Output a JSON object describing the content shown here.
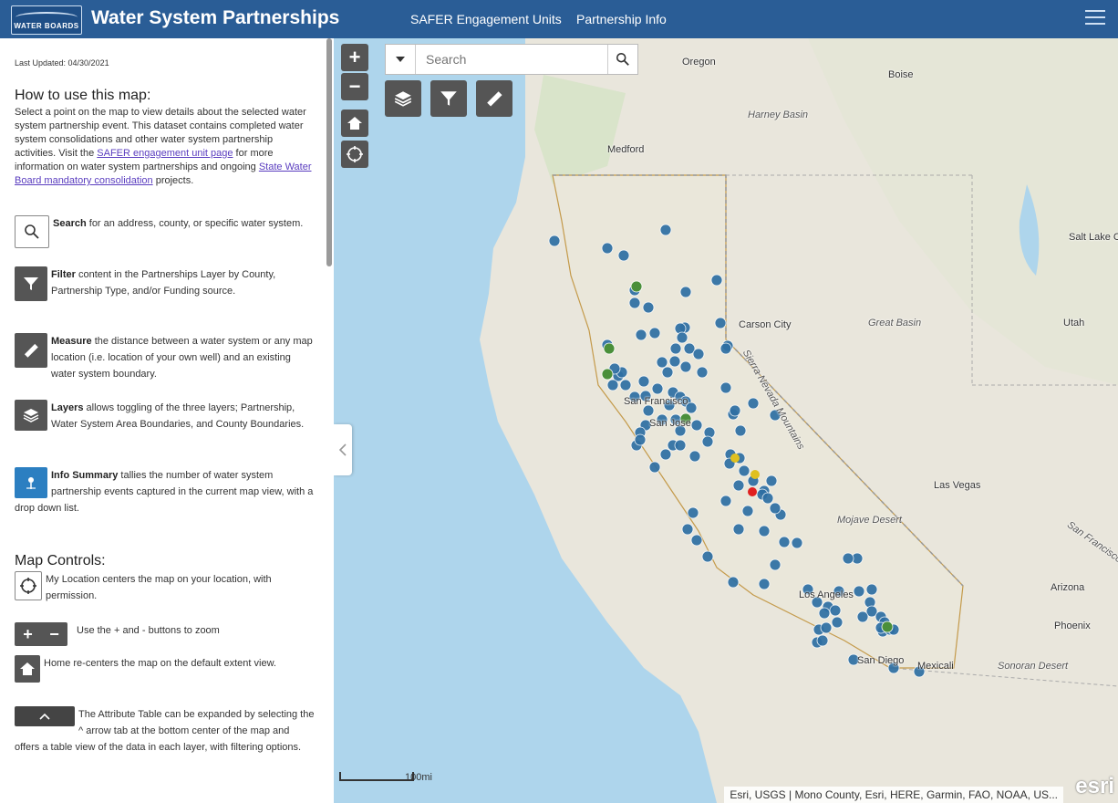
{
  "header": {
    "logo_text": "WATER BOARDS",
    "title": "Water System Partnerships",
    "nav": [
      "SAFER Engagement Units",
      "Partnership Info"
    ]
  },
  "sidebar": {
    "last_updated": "Last Updated: 04/30/2021",
    "how_to_heading": "How to use this map:",
    "intro_1": "Select a point on the map to view details about the selected water system partnership event. This dataset contains completed water system consolidations and other water system partnership activities. Visit the ",
    "intro_link_1": "SAFER engagement unit page",
    "intro_2": " for more information on water system partnerships and ongoing ",
    "intro_link_2": "State Water Board mandatory consolidation",
    "intro_3": " projects.",
    "search_bold": "Search",
    "search_text": " for an address, county, or specific water system.",
    "filter_bold": "Filter",
    "filter_text": " content in the Partnerships Layer by County, Partnership Type, and/or Funding source.",
    "measure_bold": "Measure",
    "measure_text": " the distance between a water system or any map location (i.e. location of your own well) and an existing water system boundary.",
    "layers_bold": "Layers",
    "layers_text": " allows toggling of the three layers; Partnership, Water System Area Boundaries, and County Boundaries.",
    "info_bold": "Info Summary",
    "info_text": " tallies the number of water system partnership events captured in the current map view, with a drop down list.",
    "controls_heading": "Map Controls:",
    "location_text": "My Location centers the map on your location, with permission.",
    "zoom_text": "Use the + and - buttons to zoom",
    "home_text": "Home re-centers the map on the default extent view.",
    "table_text": "The Attribute Table can be expanded by selecting the ^ arrow tab at the bottom center of the map and offers a table view of the data in each layer, with filtering options."
  },
  "map": {
    "search_placeholder": "Search",
    "zoom_in": "+",
    "zoom_out": "−",
    "scale_label": "100mi",
    "attribution": "Esri, USGS | Mono County, Esri, HERE, Garmin, FAO, NOAA, US...",
    "esri": "esri",
    "places": [
      "Oregon",
      "Boise",
      "Harney Basin",
      "Medford",
      "Carson City",
      "Great Basin",
      "Utah",
      "Salt Lake C",
      "San Francisco",
      "San Jose",
      "Las Vegas",
      "Mojave Desert",
      "Los Angeles",
      "San Diego",
      "Mexicali",
      "Sonoran Desert",
      "Phoenix",
      "Arizona",
      "Sierra Nevada Mountains",
      "San Francisco Peaks"
    ]
  },
  "colors": {
    "header": "#2a5d96",
    "point": "#2e6fa3",
    "point_green": "#4a8f3a",
    "point_yellow": "#e0c020",
    "point_red": "#e02020"
  }
}
